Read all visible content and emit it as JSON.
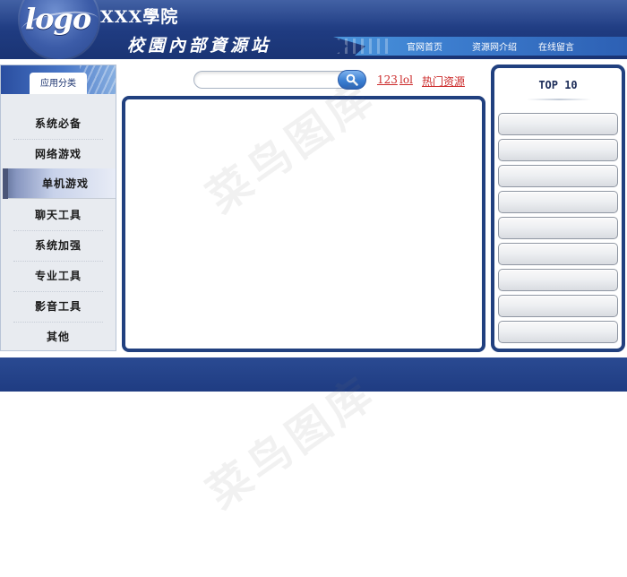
{
  "header": {
    "logo_text": "logo",
    "school_name": "XXX學院",
    "site_subtitle": "校園內部資源站",
    "nav": [
      {
        "label": "官网首页"
      },
      {
        "label": "资源网介绍"
      },
      {
        "label": "在线留言"
      }
    ]
  },
  "sidebar": {
    "title": "应用分类",
    "items": [
      {
        "label": "系统必备"
      },
      {
        "label": "网络游戏"
      },
      {
        "label": "单机游戏"
      },
      {
        "label": "聊天工具"
      },
      {
        "label": "系统加强"
      },
      {
        "label": "专业工具"
      },
      {
        "label": "影音工具"
      },
      {
        "label": "其他"
      }
    ],
    "active_item": "单机游戏"
  },
  "search": {
    "value": "",
    "placeholder": "",
    "icon": "search-icon"
  },
  "hot_links": [
    {
      "label": "123"
    },
    {
      "label": "lol"
    },
    {
      "label": "热门资源"
    }
  ],
  "top10": {
    "title": "TOP 10",
    "items": [
      "",
      "",
      "",
      "",
      "",
      "",
      "",
      "",
      ""
    ]
  },
  "watermark": {
    "text": "菜鸟图库"
  },
  "colors": {
    "header_blue": "#1f3b80",
    "panel_border": "#21407f",
    "link_red": "#cc2b2b"
  }
}
